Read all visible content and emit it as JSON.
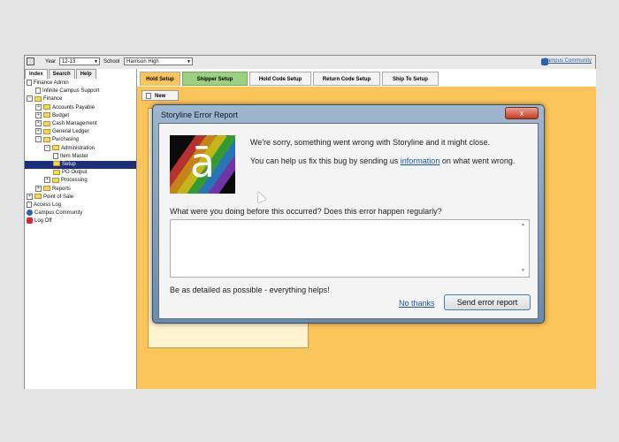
{
  "topbar": {
    "year_label": "Year",
    "year_value": "12-13",
    "school_label": "School",
    "school_value": "Harrison High",
    "community_link": "Campus Community"
  },
  "sidebar": {
    "tabs": [
      "Index",
      "Search",
      "Help"
    ],
    "tree": [
      {
        "label": "Finance Admin",
        "icon": "doc",
        "indent": 0
      },
      {
        "label": "Infinite Campus Support",
        "icon": "doc",
        "indent": 1
      },
      {
        "label": "Finance",
        "icon": "folder",
        "indent": 0,
        "expand": "-"
      },
      {
        "label": "Accounts Payable",
        "icon": "folder",
        "indent": 1,
        "expand": "+"
      },
      {
        "label": "Budget",
        "icon": "folder",
        "indent": 1,
        "expand": "+"
      },
      {
        "label": "Cash Management",
        "icon": "folder",
        "indent": 1,
        "expand": "+"
      },
      {
        "label": "General Ledger",
        "icon": "folder",
        "indent": 1,
        "expand": "+"
      },
      {
        "label": "Purchasing",
        "icon": "folder",
        "indent": 1,
        "expand": "-"
      },
      {
        "label": "Administration",
        "icon": "folder",
        "indent": 2,
        "expand": "-"
      },
      {
        "label": "Item Master",
        "icon": "doc",
        "indent": 3
      },
      {
        "label": "Setup",
        "icon": "folder",
        "indent": 3,
        "selected": true
      },
      {
        "label": "PO Output",
        "icon": "folder",
        "indent": 3
      },
      {
        "label": "Processing",
        "icon": "folder",
        "indent": 2,
        "expand": "+"
      },
      {
        "label": "Reports",
        "icon": "folder",
        "indent": 1,
        "expand": "+"
      },
      {
        "label": "Point of Sale",
        "icon": "folder",
        "indent": 0,
        "expand": "+"
      },
      {
        "label": "Access Log",
        "icon": "doc",
        "indent": 0
      },
      {
        "label": "Campus Community",
        "icon": "globe",
        "indent": 0
      },
      {
        "label": "Log Off",
        "icon": "logoff",
        "indent": 0
      }
    ]
  },
  "main": {
    "tabs": [
      "Hold Setup",
      "Shipper Setup",
      "Hold Code Setup",
      "Return Code Setup",
      "Ship To Setup"
    ],
    "new_button": "New"
  },
  "dialog": {
    "title": "Storyline Error Report",
    "close_glyph": "x",
    "logo_glyph": "ā",
    "message1": "We're sorry, something went wrong with Storyline and it might close.",
    "message2_pre": "You can help us fix this bug by sending us ",
    "message2_link": "information",
    "message2_post": " on what went wrong.",
    "question": "What were you doing before this occurred?  Does this error happen regularly?",
    "textarea_value": "",
    "hint": "Be as detailed as possible - everything helps!",
    "no_thanks": "No thanks",
    "send_button": "Send error report"
  },
  "colors": {
    "main_bg": "#fcc55a",
    "selected_tab": "#9bd17e",
    "tree_selected": "#1e2f7a"
  }
}
